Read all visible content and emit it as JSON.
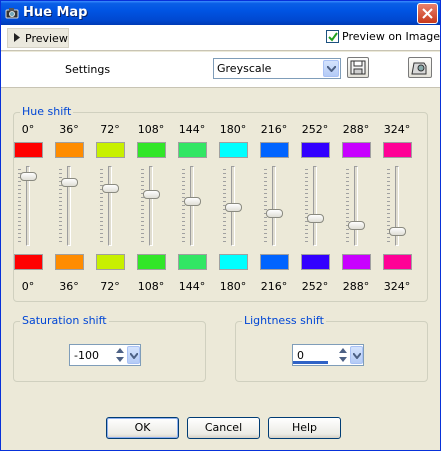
{
  "window": {
    "title": "Hue Map",
    "app_icon": "camera-icon",
    "close_icon": "close-icon"
  },
  "preview": {
    "toggle_label": "Preview",
    "checkbox_label": "Preview on Image",
    "checked": true
  },
  "settings": {
    "label": "Settings",
    "preset_value": "Greyscale",
    "save_icon": "save-preset-icon",
    "reset_icon": "reset-icon"
  },
  "hue_shift": {
    "title": "Hue shift",
    "channels": [
      {
        "label": "0°",
        "color": "#ff0000",
        "level": 0.92
      },
      {
        "label": "36°",
        "color": "#ff8c00",
        "level": 0.83
      },
      {
        "label": "72°",
        "color": "#c8f000",
        "level": 0.74
      },
      {
        "label": "108°",
        "color": "#32e628",
        "level": 0.66
      },
      {
        "label": "144°",
        "color": "#32e664",
        "level": 0.57
      },
      {
        "label": "180°",
        "color": "#00ffff",
        "level": 0.48
      },
      {
        "label": "216°",
        "color": "#0064ff",
        "level": 0.4
      },
      {
        "label": "252°",
        "color": "#3200ff",
        "level": 0.32
      },
      {
        "label": "288°",
        "color": "#c800ff",
        "level": 0.23
      },
      {
        "label": "324°",
        "color": "#ff0096",
        "level": 0.14
      }
    ]
  },
  "saturation": {
    "title": "Saturation shift",
    "value": "-100"
  },
  "lightness": {
    "title": "Lightness shift",
    "value": "0"
  },
  "buttons": {
    "ok": "OK",
    "cancel": "Cancel",
    "help": "Help"
  }
}
